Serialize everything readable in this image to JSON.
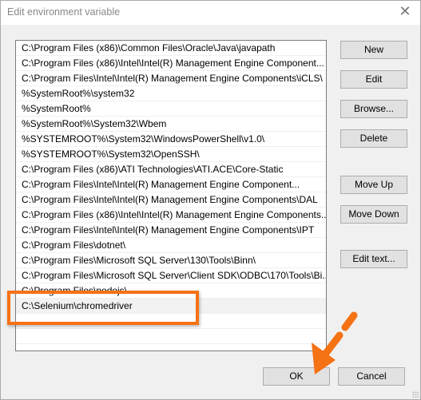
{
  "window": {
    "title": "Edit environment variable",
    "close_icon": "close-icon"
  },
  "paths": [
    "C:\\Program Files (x86)\\Common Files\\Oracle\\Java\\javapath",
    "C:\\Program Files (x86)\\Intel\\Intel(R) Management Engine Component...",
    "C:\\Program Files\\Intel\\Intel(R) Management Engine Components\\iCLS\\",
    "%SystemRoot%\\system32",
    "%SystemRoot%",
    "%SystemRoot%\\System32\\Wbem",
    "%SYSTEMROOT%\\System32\\WindowsPowerShell\\v1.0\\",
    "%SYSTEMROOT%\\System32\\OpenSSH\\",
    "C:\\Program Files (x86)\\ATI Technologies\\ATI.ACE\\Core-Static",
    "C:\\Program Files\\Intel\\Intel(R) Management Engine Component...",
    "C:\\Program Files\\Intel\\Intel(R) Management Engine Components\\DAL",
    "C:\\Program Files (x86)\\Intel\\Intel(R) Management Engine Components...",
    "C:\\Program Files\\Intel\\Intel(R) Management Engine Components\\IPT",
    "C:\\Program Files\\dotnet\\",
    "C:\\Program Files\\Microsoft SQL Server\\130\\Tools\\Binn\\",
    "C:\\Program Files\\Microsoft SQL Server\\Client SDK\\ODBC\\170\\Tools\\Bi...",
    "C:\\Program Files\\nodejs\\",
    "C:\\Selenium\\chromedriver"
  ],
  "selected_index": 17,
  "buttons": {
    "new": "New",
    "edit": "Edit",
    "browse": "Browse...",
    "delete": "Delete",
    "move_up": "Move Up",
    "move_down": "Move Down",
    "edit_text": "Edit text...",
    "ok": "OK",
    "cancel": "Cancel"
  },
  "annotation_color": "#f57215"
}
